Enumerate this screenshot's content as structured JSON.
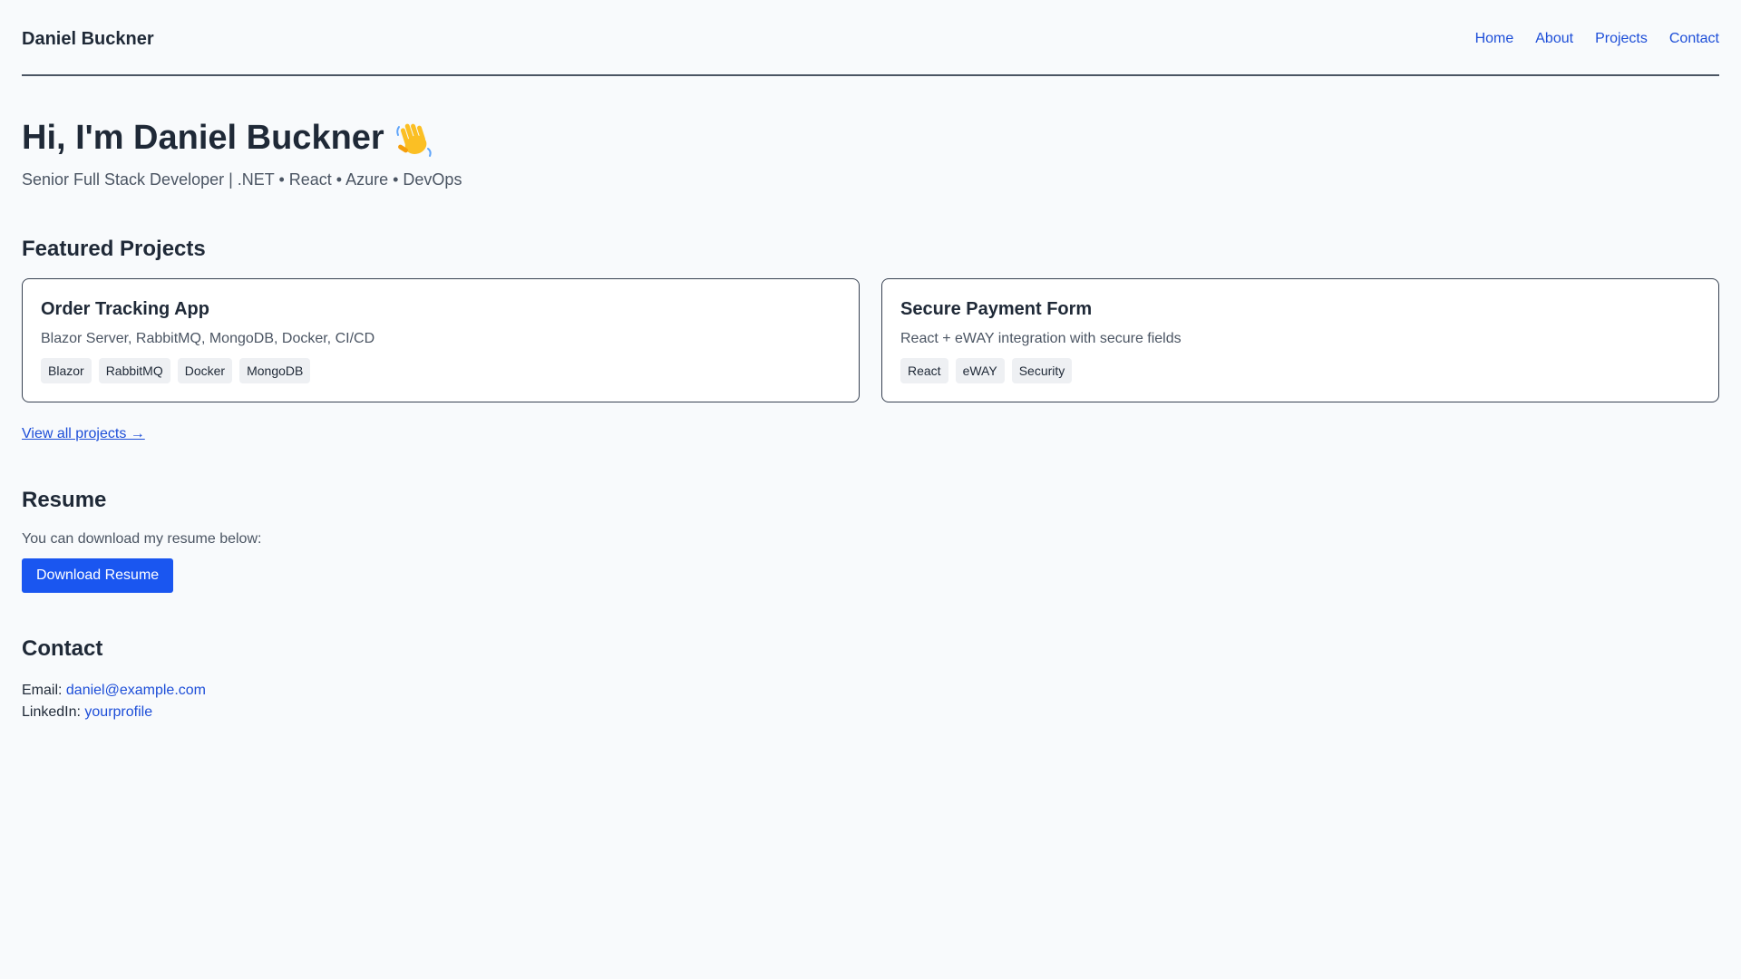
{
  "header": {
    "brand": "Daniel Buckner",
    "nav": [
      "Home",
      "About",
      "Projects",
      "Contact"
    ]
  },
  "hero": {
    "title": "Hi, I'm Daniel Buckner",
    "icon": "waving-hand-icon",
    "subtitle": "Senior Full Stack Developer | .NET • React • Azure • DevOps"
  },
  "projects": {
    "heading": "Featured Projects",
    "cards": [
      {
        "title": "Order Tracking App",
        "description": "Blazor Server, RabbitMQ, MongoDB, Docker, CI/CD",
        "tags": [
          "Blazor",
          "RabbitMQ",
          "Docker",
          "MongoDB"
        ]
      },
      {
        "title": "Secure Payment Form",
        "description": "React + eWAY integration with secure fields",
        "tags": [
          "React",
          "eWAY",
          "Security"
        ]
      }
    ],
    "view_all": "View all projects →"
  },
  "resume": {
    "heading": "Resume",
    "text": "You can download my resume below:",
    "button": "Download Resume"
  },
  "contact": {
    "heading": "Contact",
    "email_label": "Email:",
    "email": "daniel@example.com",
    "linkedin_label": "LinkedIn:",
    "linkedin": "yourprofile"
  },
  "colors": {
    "accent": "#1d4ed8",
    "button": "#1a56f0",
    "background": "#f8fafc",
    "text": "#1f2937"
  }
}
